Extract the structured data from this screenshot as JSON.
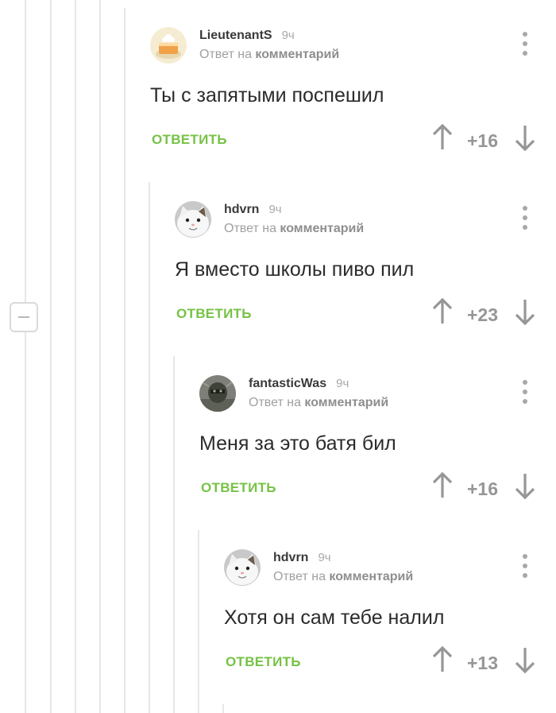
{
  "common": {
    "reply_prefix": "Ответ на",
    "reply_target": "комментарий",
    "reply_button": "ОТВЕТИТЬ"
  },
  "comments": [
    {
      "author": "LieutenantS",
      "time": "9ч",
      "text": "Ты с запятыми поспешил",
      "score": "+16",
      "avatar_icon": "cake-avatar"
    },
    {
      "author": "hdvrn",
      "time": "9ч",
      "text": "Я вместо школы пиво пил",
      "score": "+23",
      "avatar_icon": "white-cat-avatar"
    },
    {
      "author": "fantasticWas",
      "time": "9ч",
      "text": "Меня за это батя бил",
      "score": "+16",
      "avatar_icon": "helmet-avatar"
    },
    {
      "author": "hdvrn",
      "time": "9ч",
      "text": "Хотя он сам тебе налил",
      "score": "+13",
      "avatar_icon": "white-cat-avatar"
    }
  ],
  "colors": {
    "reply_green": "#76c245",
    "score_gray": "#969696",
    "thread_line": "#e7e7e7"
  }
}
